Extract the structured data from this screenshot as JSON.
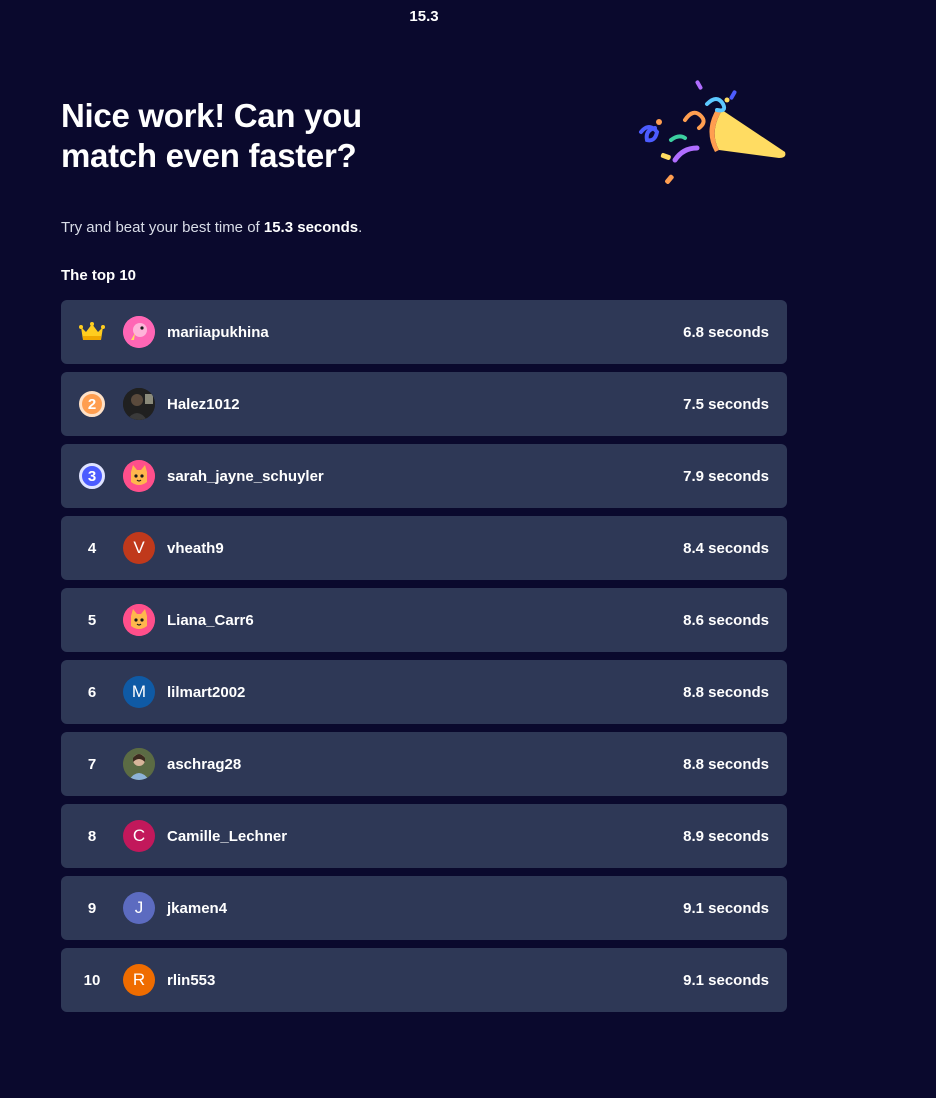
{
  "timer": "15.3",
  "headline": "Nice work! Can you match even faster?",
  "subtitle": {
    "prefix": "Try and beat your best time of ",
    "best": "15.3 seconds",
    "suffix": "."
  },
  "section_title": "The top 10",
  "leaders": [
    {
      "rank": "1",
      "name": "mariiapukhina",
      "time": "6.8 seconds"
    },
    {
      "rank": "2",
      "name": "Halez1012",
      "time": "7.5 seconds"
    },
    {
      "rank": "3",
      "name": "sarah_jayne_schuyler",
      "time": "7.9 seconds"
    },
    {
      "rank": "4",
      "name": "vheath9",
      "time": "8.4 seconds",
      "initial": "V",
      "color": "#c0391b"
    },
    {
      "rank": "5",
      "name": "Liana_Carr6",
      "time": "8.6 seconds"
    },
    {
      "rank": "6",
      "name": "lilmart2002",
      "time": "8.8 seconds",
      "initial": "M",
      "color": "#0f5aa5"
    },
    {
      "rank": "7",
      "name": "aschrag28",
      "time": "8.8 seconds"
    },
    {
      "rank": "8",
      "name": "Camille_Lechner",
      "time": "8.9 seconds",
      "initial": "C",
      "color": "#c2185b"
    },
    {
      "rank": "9",
      "name": "jkamen4",
      "time": "9.1 seconds",
      "initial": "J",
      "color": "#5c6bc0"
    },
    {
      "rank": "10",
      "name": "rlin553",
      "time": "9.1 seconds",
      "initial": "R",
      "color": "#ef6c00"
    }
  ],
  "icons": {
    "first_place": "crown-icon",
    "celebration": "party-popper-icon"
  }
}
